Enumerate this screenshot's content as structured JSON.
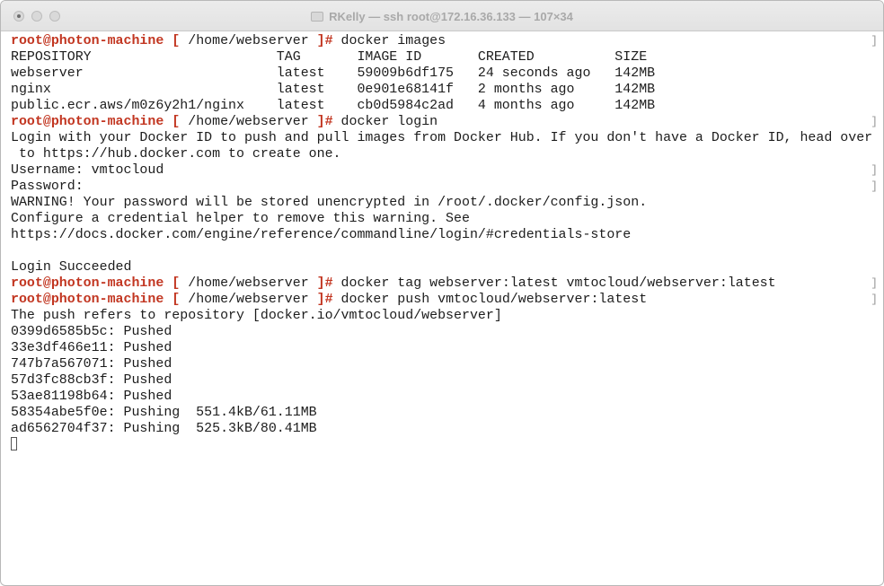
{
  "window": {
    "title": "RKelly — ssh root@172.16.36.133 — 107×34"
  },
  "prompt": {
    "user_host": "root@photon-machine",
    "open": "[",
    "path": " /home/webserver ",
    "close": "]#"
  },
  "lines": [
    {
      "kind": "cmd",
      "text": " docker images",
      "mark": "]"
    },
    {
      "kind": "out",
      "text": "REPOSITORY                       TAG       IMAGE ID       CREATED          SIZE"
    },
    {
      "kind": "out",
      "text": "webserver                        latest    59009b6df175   24 seconds ago   142MB"
    },
    {
      "kind": "out",
      "text": "nginx                            latest    0e901e68141f   2 months ago     142MB"
    },
    {
      "kind": "out",
      "text": "public.ecr.aws/m0z6y2h1/nginx    latest    cb0d5984c2ad   4 months ago     142MB"
    },
    {
      "kind": "cmd",
      "text": " docker login",
      "mark": "]"
    },
    {
      "kind": "out",
      "text": "Login with your Docker ID to push and pull images from Docker Hub. If you don't have a Docker ID, head over"
    },
    {
      "kind": "out",
      "text": " to https://hub.docker.com to create one."
    },
    {
      "kind": "out",
      "text": "Username: vmtocloud",
      "mark": "]"
    },
    {
      "kind": "out",
      "text": "Password:",
      "mark": "]"
    },
    {
      "kind": "out",
      "text": "WARNING! Your password will be stored unencrypted in /root/.docker/config.json."
    },
    {
      "kind": "out",
      "text": "Configure a credential helper to remove this warning. See"
    },
    {
      "kind": "out",
      "text": "https://docs.docker.com/engine/reference/commandline/login/#credentials-store"
    },
    {
      "kind": "out",
      "text": ""
    },
    {
      "kind": "out",
      "text": "Login Succeeded"
    },
    {
      "kind": "cmd",
      "text": " docker tag webserver:latest vmtocloud/webserver:latest",
      "mark": "]"
    },
    {
      "kind": "cmd",
      "text": " docker push vmtocloud/webserver:latest",
      "mark": "]"
    },
    {
      "kind": "out",
      "text": "The push refers to repository [docker.io/vmtocloud/webserver]"
    },
    {
      "kind": "out",
      "text": "0399d6585b5c: Pushed"
    },
    {
      "kind": "out",
      "text": "33e3df466e11: Pushed"
    },
    {
      "kind": "out",
      "text": "747b7a567071: Pushed"
    },
    {
      "kind": "out",
      "text": "57d3fc88cb3f: Pushed"
    },
    {
      "kind": "out",
      "text": "53ae81198b64: Pushed"
    },
    {
      "kind": "out",
      "text": "58354abe5f0e: Pushing  551.4kB/61.11MB"
    },
    {
      "kind": "out",
      "text": "ad6562704f37: Pushing  525.3kB/80.41MB"
    }
  ]
}
